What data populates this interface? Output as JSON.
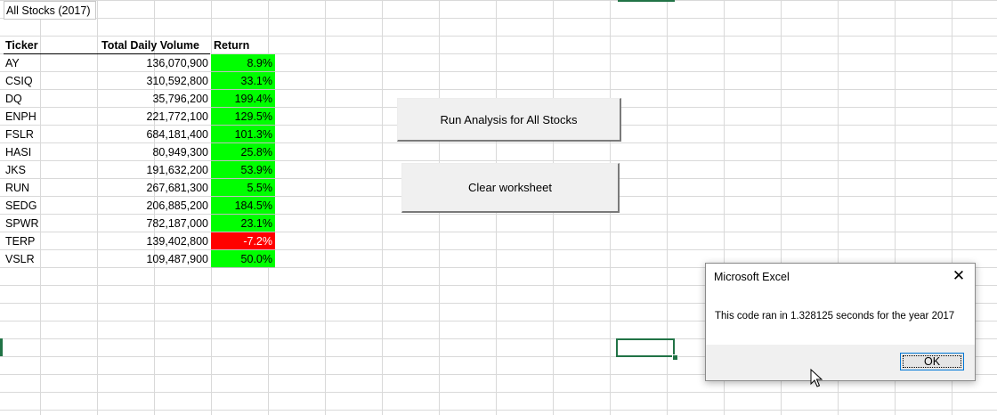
{
  "sheet": {
    "title": "All Stocks (2017)",
    "headers": {
      "ticker": "Ticker",
      "volume": "Total Daily Volume",
      "return": "Return"
    },
    "rows": [
      {
        "ticker": "AY",
        "volume": "136,070,900",
        "return": "8.9%",
        "color": "#00ff00"
      },
      {
        "ticker": "CSIQ",
        "volume": "310,592,800",
        "return": "33.1%",
        "color": "#00ff00"
      },
      {
        "ticker": "DQ",
        "volume": "35,796,200",
        "return": "199.4%",
        "color": "#00ff00"
      },
      {
        "ticker": "ENPH",
        "volume": "221,772,100",
        "return": "129.5%",
        "color": "#00ff00"
      },
      {
        "ticker": "FSLR",
        "volume": "684,181,400",
        "return": "101.3%",
        "color": "#00ff00"
      },
      {
        "ticker": "HASI",
        "volume": "80,949,300",
        "return": "25.8%",
        "color": "#00ff00"
      },
      {
        "ticker": "JKS",
        "volume": "191,632,200",
        "return": "53.9%",
        "color": "#00ff00"
      },
      {
        "ticker": "RUN",
        "volume": "267,681,300",
        "return": "5.5%",
        "color": "#00ff00"
      },
      {
        "ticker": "SEDG",
        "volume": "206,885,200",
        "return": "184.5%",
        "color": "#00ff00"
      },
      {
        "ticker": "SPWR",
        "volume": "782,187,000",
        "return": "23.1%",
        "color": "#00ff00"
      },
      {
        "ticker": "TERP",
        "volume": "139,402,800",
        "return": "-7.2%",
        "color": "#ff0000"
      },
      {
        "ticker": "VSLR",
        "volume": "109,487,900",
        "return": "50.0%",
        "color": "#00ff00"
      }
    ]
  },
  "buttons": {
    "run_analysis": "Run Analysis for All Stocks",
    "clear_worksheet": "Clear worksheet"
  },
  "dialog": {
    "title": "Microsoft Excel",
    "message": "This code ran in 1.328125 seconds for the year 2017",
    "ok_label": "OK",
    "close_glyph": "✕"
  },
  "colors": {
    "positive": "#00ff00",
    "negative": "#ff0000",
    "accent": "#217346"
  }
}
